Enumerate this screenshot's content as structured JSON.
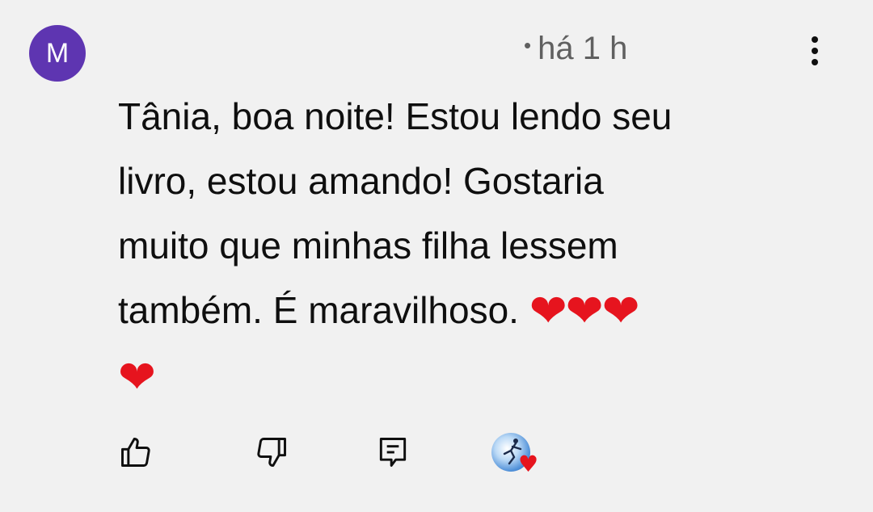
{
  "comment": {
    "author_initial": "M",
    "timestamp": "há 1 h",
    "text_lines": [
      "Tânia, boa noite! Estou lendo seu",
      "livro, estou amando! Gostaria",
      "muito que minhas filha lessem",
      "também. É maravilhoso."
    ],
    "trailing_emoji_line1": "❤❤❤",
    "trailing_emoji_line2": "❤"
  },
  "actions": {
    "like_icon": "thumbs-up-icon",
    "dislike_icon": "thumbs-down-icon",
    "reply_icon": "reply-comment-icon",
    "creator_heart_icon": "creator-heart-badge-icon"
  },
  "colors": {
    "avatar_bg": "#5e35b1",
    "heart": "#e6141e",
    "background": "#f1f1f1"
  }
}
